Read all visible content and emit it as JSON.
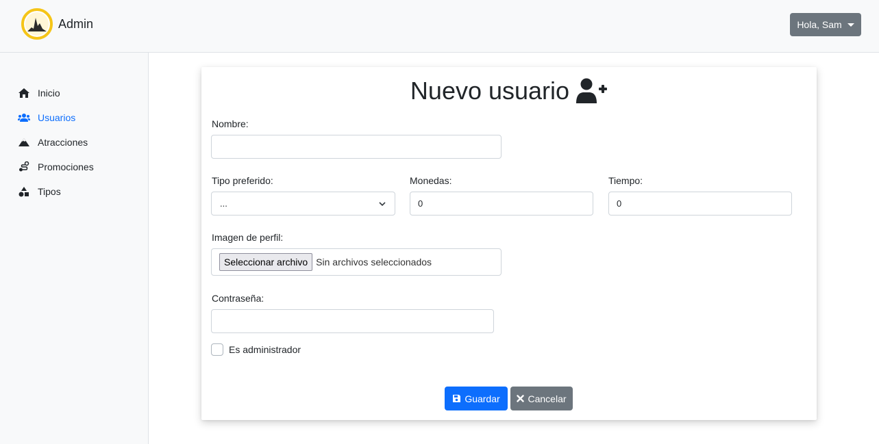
{
  "navbar": {
    "brand_text": "Admin",
    "user_menu_label": "Hola, Sam"
  },
  "sidebar": {
    "items": [
      {
        "label": "Inicio",
        "icon": "home-icon",
        "active": false
      },
      {
        "label": "Usuarios",
        "icon": "users-icon",
        "active": true
      },
      {
        "label": "Atracciones",
        "icon": "mountain-icon",
        "active": false
      },
      {
        "label": "Promociones",
        "icon": "route-icon",
        "active": false
      },
      {
        "label": "Tipos",
        "icon": "shapes-icon",
        "active": false
      }
    ]
  },
  "form": {
    "title": "Nuevo usuario",
    "title_icon": "user-plus-icon",
    "nombre": {
      "label": "Nombre:",
      "value": ""
    },
    "tipo_preferido": {
      "label": "Tipo preferido:",
      "selected": "..."
    },
    "monedas": {
      "label": "Monedas:",
      "value": "0"
    },
    "tiempo": {
      "label": "Tiempo:",
      "value": "0"
    },
    "imagen": {
      "label": "Imagen de perfil:",
      "button_label": "Seleccionar archivo",
      "status": "Sin archivos seleccionados"
    },
    "password": {
      "label": "Contraseña:",
      "value": ""
    },
    "admin_checkbox": {
      "label": "Es administrador",
      "checked": false
    },
    "save_label": "Guardar",
    "cancel_label": "Cancelar"
  },
  "colors": {
    "primary": "#0d6efd",
    "secondary": "#6c757d",
    "sidebar_bg": "#f8f9fa",
    "logo_ring": "#f5c518"
  }
}
